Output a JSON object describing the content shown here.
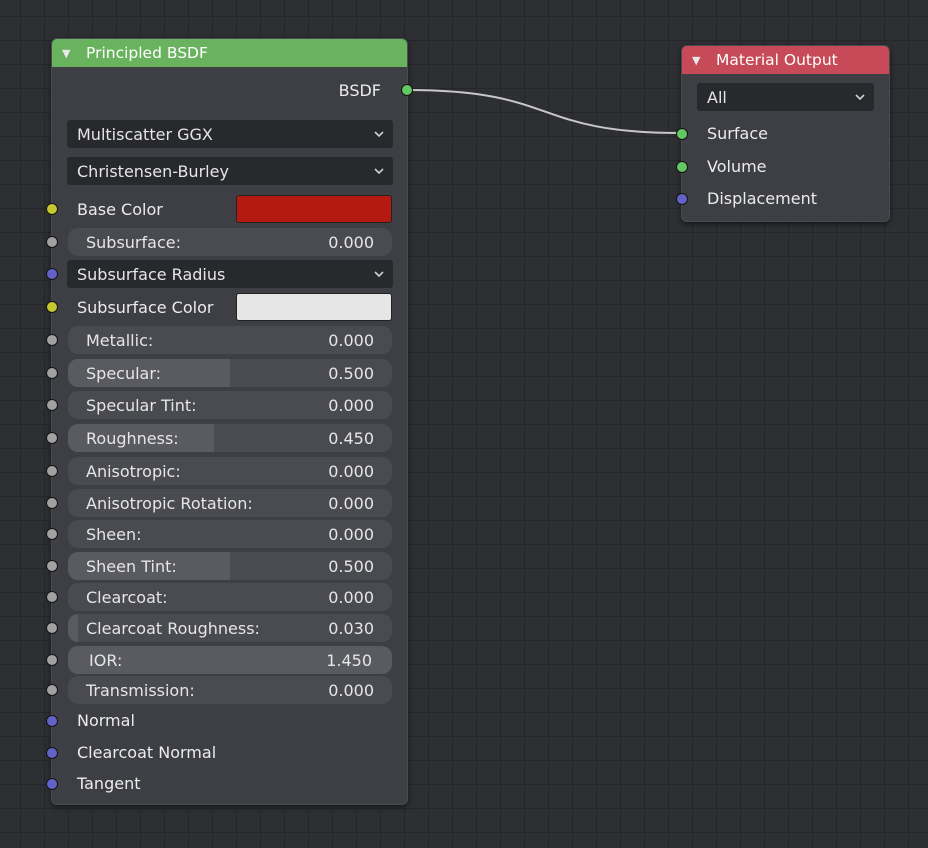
{
  "principled": {
    "title": "Principled BSDF",
    "header_color": "#69b35f",
    "output_label": "BSDF",
    "distribution": "Multiscatter GGX",
    "subsurface_method": "Christensen-Burley",
    "base_color": {
      "label": "Base Color",
      "color": "#b51a10"
    },
    "subsurface": {
      "label": "Subsurface:",
      "value": "0.000",
      "fraction": 0
    },
    "subsurface_radius": {
      "label": "Subsurface Radius"
    },
    "subsurface_color": {
      "label": "Subsurface Color",
      "color": "#e6e6e6"
    },
    "metallic": {
      "label": "Metallic:",
      "value": "0.000",
      "fraction": 0
    },
    "specular": {
      "label": "Specular:",
      "value": "0.500",
      "fraction": 0.5
    },
    "specular_tint": {
      "label": "Specular Tint:",
      "value": "0.000",
      "fraction": 0
    },
    "roughness": {
      "label": "Roughness:",
      "value": "0.450",
      "fraction": 0.45
    },
    "anisotropic": {
      "label": "Anisotropic:",
      "value": "0.000",
      "fraction": 0
    },
    "anisotropic_rotation": {
      "label": "Anisotropic Rotation:",
      "value": "0.000",
      "fraction": 0
    },
    "sheen": {
      "label": "Sheen:",
      "value": "0.000",
      "fraction": 0
    },
    "sheen_tint": {
      "label": "Sheen Tint:",
      "value": "0.500",
      "fraction": 0.5
    },
    "clearcoat": {
      "label": "Clearcoat:",
      "value": "0.000",
      "fraction": 0
    },
    "clearcoat_roughness": {
      "label": "Clearcoat Roughness:",
      "value": "0.030",
      "fraction": 0.03
    },
    "ior": {
      "label": "IOR:",
      "value": "1.450",
      "fraction": 1.0
    },
    "transmission": {
      "label": "Transmission:",
      "value": "0.000",
      "fraction": 0
    },
    "normal": {
      "label": "Normal"
    },
    "clearcoat_normal": {
      "label": "Clearcoat Normal"
    },
    "tangent": {
      "label": "Tangent"
    }
  },
  "material_output": {
    "title": "Material Output",
    "header_color": "#c64a57",
    "target": "All",
    "surface": "Surface",
    "volume": "Volume",
    "displacement": "Displacement"
  },
  "socket_colors": {
    "float": "#a1a1a1",
    "color": "#c7c72e",
    "vector": "#6363c7",
    "shader": "#63c763"
  }
}
